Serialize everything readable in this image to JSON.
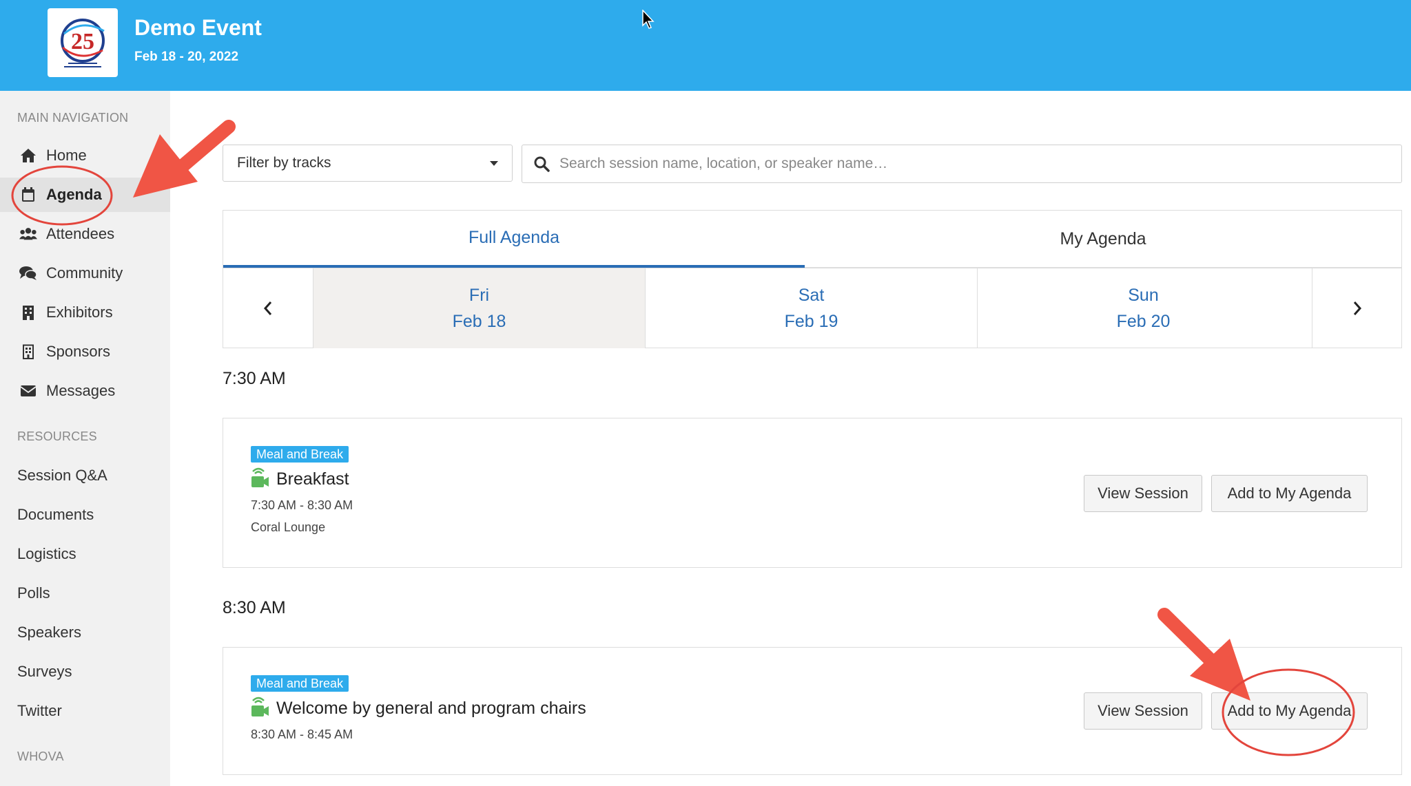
{
  "header": {
    "title": "Demo Event",
    "dates": "Feb 18 - 20, 2022",
    "logo_text": "25"
  },
  "sidebar": {
    "main_label": "MAIN NAVIGATION",
    "main_items": [
      {
        "label": "Home",
        "icon": "home-icon"
      },
      {
        "label": "Agenda",
        "icon": "calendar-icon",
        "active": true
      },
      {
        "label": "Attendees",
        "icon": "users-icon"
      },
      {
        "label": "Community",
        "icon": "chat-icon"
      },
      {
        "label": "Exhibitors",
        "icon": "building-icon"
      },
      {
        "label": "Sponsors",
        "icon": "building-outline-icon"
      },
      {
        "label": "Messages",
        "icon": "envelope-icon"
      }
    ],
    "resources_label": "RESOURCES",
    "resource_items": [
      "Session Q&A",
      "Documents",
      "Logistics",
      "Polls",
      "Speakers",
      "Surveys",
      "Twitter"
    ],
    "whova_label": "WHOVA"
  },
  "filters": {
    "tracks_label": "Filter by tracks",
    "search_placeholder": "Search session name, location, or speaker name…"
  },
  "tabs": {
    "full": "Full Agenda",
    "my": "My Agenda"
  },
  "days": [
    {
      "dow": "Fri",
      "date": "Feb 18",
      "selected": true
    },
    {
      "dow": "Sat",
      "date": "Feb 19"
    },
    {
      "dow": "Sun",
      "date": "Feb 20"
    }
  ],
  "agenda": {
    "slots": [
      {
        "time": "7:30 AM",
        "session": {
          "badge": "Meal and Break",
          "title": "Breakfast",
          "time_range": "7:30 AM - 8:30 AM",
          "location": "Coral Lounge"
        }
      },
      {
        "time": "8:30 AM",
        "session": {
          "badge": "Meal and Break",
          "title": "Welcome by general and program chairs",
          "time_range": "8:30 AM - 8:45 AM"
        }
      }
    ],
    "view_label": "View Session",
    "add_label": "Add to My Agenda"
  },
  "colors": {
    "header_bg": "#2eabec",
    "accent": "#2a6db5",
    "annotation": "#f05545",
    "video_icon": "#5cb85c"
  }
}
